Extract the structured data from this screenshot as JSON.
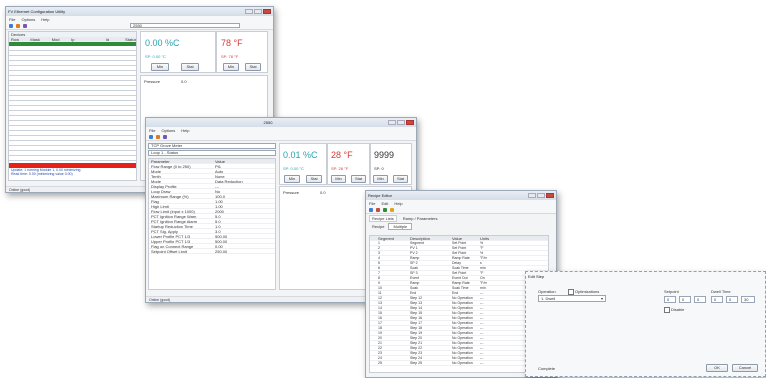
{
  "windows": {
    "w1": {
      "title": "FV Ethernet Configuration Utility",
      "menu": [
        "File",
        "Options",
        "Help"
      ],
      "address_value": "2550",
      "left_header": "Devices",
      "grid_headers": [
        "Row",
        "Mask",
        "Mod",
        "Ip",
        "Id",
        "Status"
      ],
      "value_red": "78 °F",
      "value_teal": "0.00 %C",
      "sub_teal": "SP: 0.00 °C",
      "sub_red": "SP: 78 °F",
      "btn_labels": [
        "Min",
        "Stat",
        "Min",
        "Stat"
      ],
      "field_a": "Pressure",
      "field_b": "0.0",
      "status": "Online (good)",
      "log_lines": [
        "Update: 1 running Module 1, 0.00 minimizing",
        "Read time: 0.00 (minimizing value 0.00)"
      ]
    },
    "w2": {
      "title": "2550",
      "menu": [
        "File",
        "Options",
        "Help"
      ],
      "device_select": "TCP Grove Meter",
      "loop_select": "Loop 1 - Status",
      "prop_headers": [
        "Parameter",
        "Value"
      ],
      "props": [
        [
          "Flow Range (0 to 250)",
          "Pt1"
        ],
        [
          "Mode",
          "Auto"
        ],
        [
          "Tenth",
          "None"
        ],
        [
          "Mode",
          "Data Reduction"
        ],
        [
          "Display Profile",
          "---"
        ],
        [
          "Loop Draw",
          "No"
        ],
        [
          "Maximum Range (%)",
          "100.0"
        ],
        [
          "Flag",
          "1.00"
        ],
        [
          "High Limit",
          "1.00"
        ],
        [
          "Flow Limit (Input x 1000)",
          "2000"
        ],
        [
          "PCT Ignition Range Warn",
          "5.0"
        ],
        [
          "PCT Ignition Range Alarm",
          "5.0"
        ],
        [
          "Startup Reduction Time",
          "1.0"
        ],
        [
          "PCT Sig. Apply",
          "3.0"
        ],
        [
          "Lower Profile PCT 1/3",
          "500.00"
        ],
        [
          "Upper Profile PCT 1/3",
          "500.00"
        ],
        [
          "Flag on Connect Range",
          "0.00"
        ],
        [
          "Setpoint Offset Limit",
          "250.00"
        ]
      ],
      "value_teal": "0.01 %C",
      "value_red": "28 °F",
      "value_dark": "9999",
      "sub_teal": "SP: 0.00 °C",
      "sub_red": "SP: 28 °F",
      "sub_dark": "SP: 0",
      "btn_labels": [
        "Min",
        "Stat",
        "Min",
        "Stat",
        "Min",
        "Stat"
      ],
      "field_a": "Pressure",
      "field_b": "0.0",
      "status": "Online (good)"
    },
    "w3": {
      "title": "Recipe Editor",
      "menu": [
        "File",
        "Edit",
        "Help"
      ],
      "tabs": [
        "Recipe Lists",
        "Ramp / Parameters"
      ],
      "filter_label": "Recipe",
      "filter_value": "Multiple",
      "columns": [
        "Segment",
        "Description",
        "Value",
        "Units"
      ],
      "rows": [
        [
          "1",
          "Segment",
          "Set Point",
          "%"
        ],
        [
          "2",
          "PV 1",
          "Set Point",
          "°F"
        ],
        [
          "3",
          "PV 2",
          "Set Point",
          "%"
        ],
        [
          "4",
          "Ramp",
          "Ramp Rate",
          "°F/m"
        ],
        [
          "5",
          "SP 2",
          "Delay",
          "s"
        ],
        [
          "6",
          "Soak",
          "Soak Time",
          "min"
        ],
        [
          "7",
          "SP 3",
          "Set Point",
          "°F"
        ],
        [
          "8",
          "Event",
          "Event Out",
          "On"
        ],
        [
          "9",
          "Ramp",
          "Ramp Rate",
          "°F/m"
        ],
        [
          "10",
          "Soak",
          "Soak Time",
          "min"
        ],
        [
          "11",
          "End",
          "End",
          "---"
        ],
        [
          "12",
          "Step 12",
          "No Operation",
          "---"
        ],
        [
          "13",
          "Step 13",
          "No Operation",
          "---"
        ],
        [
          "14",
          "Step 14",
          "No Operation",
          "---"
        ],
        [
          "15",
          "Step 15",
          "No Operation",
          "---"
        ],
        [
          "16",
          "Step 16",
          "No Operation",
          "---"
        ],
        [
          "17",
          "Step 17",
          "No Operation",
          "---"
        ],
        [
          "18",
          "Step 18",
          "No Operation",
          "---"
        ],
        [
          "19",
          "Step 19",
          "No Operation",
          "---"
        ],
        [
          "20",
          "Step 20",
          "No Operation",
          "---"
        ],
        [
          "21",
          "Step 21",
          "No Operation",
          "---"
        ],
        [
          "22",
          "Step 22",
          "No Operation",
          "---"
        ],
        [
          "23",
          "Step 23",
          "No Operation",
          "---"
        ],
        [
          "24",
          "Step 24",
          "No Operation",
          "---"
        ],
        [
          "25",
          "Step 25",
          "No Operation",
          "---"
        ]
      ]
    },
    "w4": {
      "title": "Edit Step",
      "operation_label": "Operation",
      "operation_value": "1. Dwell",
      "opt_label": "Optimizations",
      "setpoint_label": "Setpoint",
      "time_label": "Dwell Time",
      "sp_values": [
        "0",
        "0",
        "0"
      ],
      "time_values": [
        "0",
        "0",
        "30"
      ],
      "disable_label": "Disable",
      "status": "Complete",
      "ok_label": "OK",
      "cancel_label": "Cancel"
    }
  },
  "colors": {
    "green": "#2e8b3a",
    "red": "#e8201a",
    "teal": "#2aa3b3",
    "redval": "#d63a33",
    "dark": "#333333"
  }
}
